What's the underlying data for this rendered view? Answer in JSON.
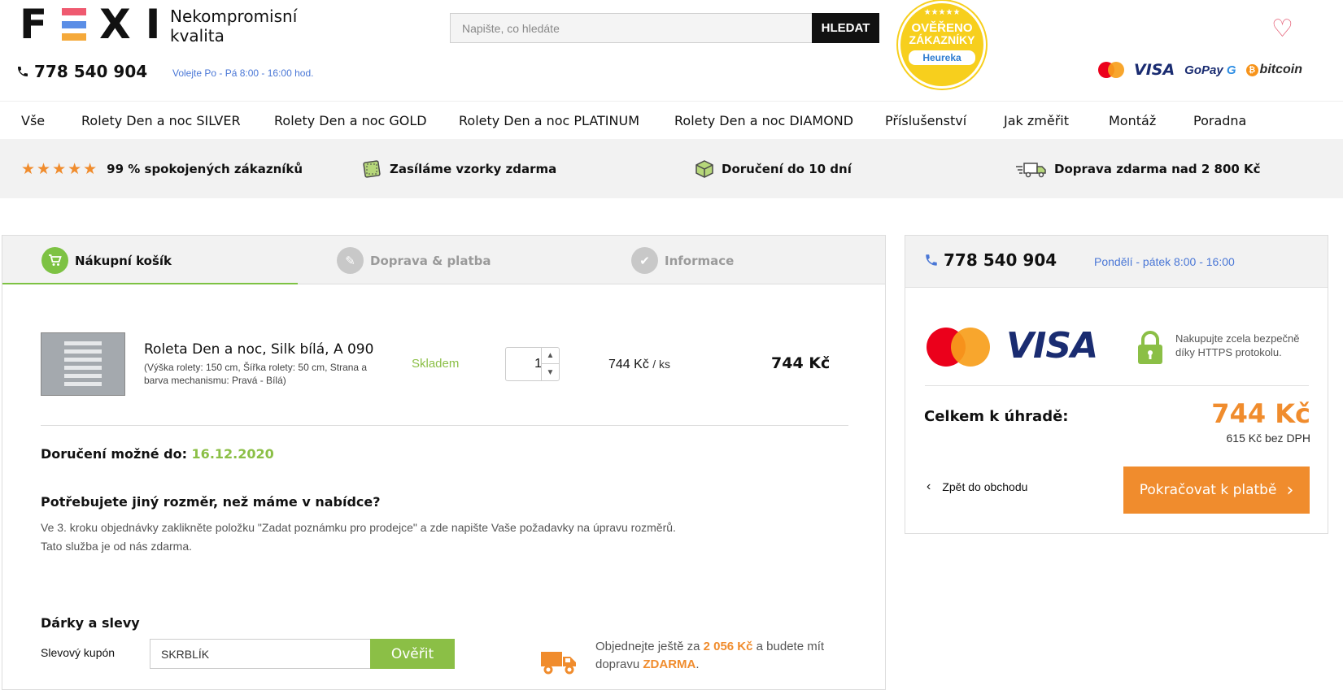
{
  "header": {
    "logo_text": "FEXI",
    "tagline_line1": "Nekompromisní",
    "tagline_line2": "kvalita",
    "phone": "778 540 904",
    "hours": "Volejte Po - Pá 8:00 - 16:00 hod.",
    "search_placeholder": "Napište, co hledáte",
    "search_button": "HLEDAT",
    "badge": {
      "line1": "OVĚŘENO",
      "line2": "ZÁKAZNÍKY",
      "brand": "Heureka",
      "color": "#f7cf1d"
    },
    "payment_logos": {
      "visa": "VISA",
      "gopay_a": "GoPay",
      "gopay_b": "G",
      "bitcoin": "bitcoin"
    }
  },
  "nav": {
    "items": [
      "Vše",
      "Rolety Den a noc SILVER",
      "Rolety Den a noc GOLD",
      "Rolety Den a noc PLATINUM",
      "Rolety Den a noc DIAMOND",
      "Příslušenství",
      "Jak změřit",
      "Montáž",
      "Poradna"
    ]
  },
  "usp": {
    "stars": "★★★★★",
    "satisfied": "99 % spokojených zákazníků",
    "samples": "Zasíláme vzorky zdarma",
    "delivery": "Doručení do 10 dní",
    "free_shipping": "Doprava zdarma nad 2 800 Kč"
  },
  "steps": [
    {
      "label": "Nákupní košík",
      "icon": "cart-icon",
      "active": true
    },
    {
      "label": "Doprava & platba",
      "icon": "pencil-icon",
      "active": false
    },
    {
      "label": "Informace",
      "icon": "check-icon",
      "active": false
    }
  ],
  "cart": {
    "item": {
      "name": "Roleta Den a noc, Silk bílá, A 090",
      "description": "(Výška rolety: 150 cm, Šířka rolety: 50 cm, Strana a barva mechanismu: Pravá - Bílá)",
      "stock": "Skladem",
      "quantity": "1",
      "unit_price": "744 Kč",
      "unit": "/ ks",
      "total": "744 Kč"
    },
    "delivery_label": "Doručení možné do:",
    "delivery_date": "16.12.2020",
    "custom_title": "Potřebujete jiný rozměr, než máme v nabídce?",
    "custom_line1": "Ve 3. kroku objednávky zaklikněte položku \"Zadat poznámku pro prodejce\" a zde napište Vaše požadavky na úpravu rozměrů.",
    "custom_line2": "Tato služba je od nás zdarma.",
    "gifts_title": "Dárky a slevy",
    "coupon_label": "Slevový kupón",
    "coupon_value": "SKRBLÍK",
    "coupon_button": "Ověřit",
    "free_ship_pre": "Objednejte ještě za",
    "free_ship_amount": "2 056 Kč",
    "free_ship_mid": "a budete mít dopravu",
    "free_ship_free": "ZDARMA",
    "free_ship_end": "."
  },
  "summary": {
    "phone": "778 540 904",
    "hours": "Pondělí - pátek 8:00 - 16:00",
    "visa": "VISA",
    "secure_text": "Nakupujte zcela bezpečně díky HTTPS protokolu.",
    "total_label": "Celkem k úhradě:",
    "total_value": "744 Kč",
    "total_novat": "615 Kč bez DPH",
    "back_link": "Zpět do obchodu",
    "continue_button": "Pokračovat k platbě"
  },
  "colors": {
    "accent_green": "#8bbf46",
    "accent_orange": "#f08c2d",
    "link_blue": "#4a77d6"
  }
}
